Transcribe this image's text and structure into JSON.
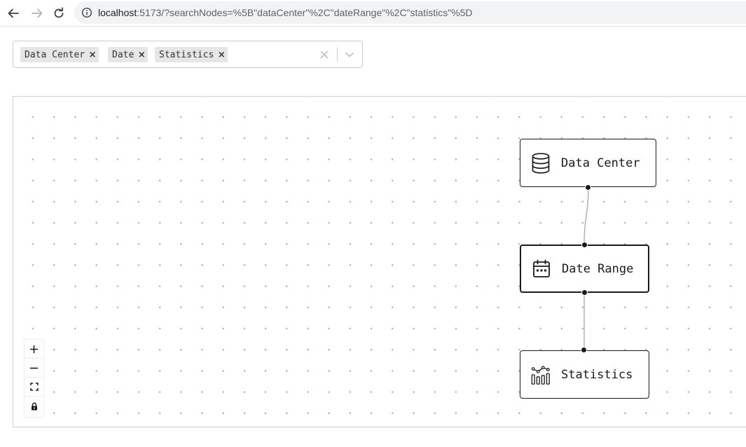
{
  "browser": {
    "url_host": "localhost",
    "url_rest": ":5173/?searchNodes=%5B\"dataCenter\"%2C\"dateRange\"%2C\"statistics\"%5D"
  },
  "search": {
    "chips": [
      {
        "label": "Data Center",
        "remove": "×"
      },
      {
        "label": "Date",
        "remove": "×"
      },
      {
        "label": "Statistics",
        "remove": "×"
      }
    ]
  },
  "nodes": [
    {
      "label": "Data Center",
      "icon": "database-icon"
    },
    {
      "label": "Date Range",
      "icon": "calendar-icon"
    },
    {
      "label": "Statistics",
      "icon": "statistics-chart-icon"
    }
  ],
  "edges": [
    {
      "from": "Data Center",
      "to": "Date Range"
    },
    {
      "from": "Date Range",
      "to": "Statistics"
    }
  ],
  "controls": [
    {
      "name": "zoom-in",
      "icon": "plus-icon"
    },
    {
      "name": "zoom-out",
      "icon": "minus-icon"
    },
    {
      "name": "fit-view",
      "icon": "fit-view-icon"
    },
    {
      "name": "toggle-interactivity",
      "icon": "lock-icon"
    }
  ],
  "colors": {
    "node_border": "#1a1a1a",
    "edge": "#b1b1b7",
    "chip_bg": "#e6e6e6",
    "dots": "#a9a9a9"
  }
}
